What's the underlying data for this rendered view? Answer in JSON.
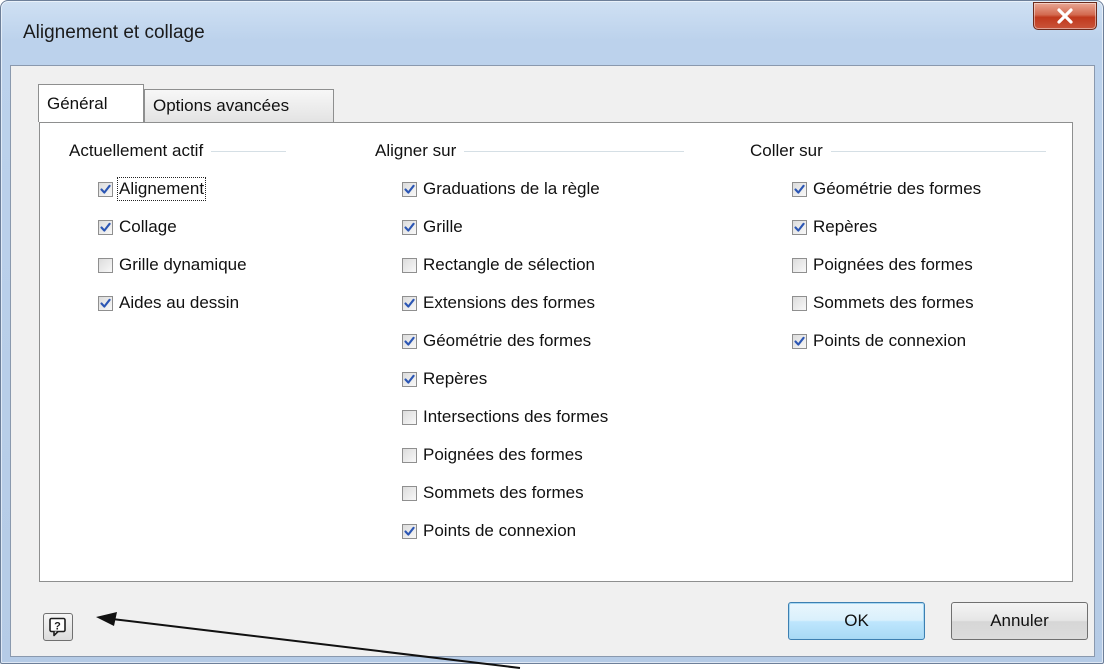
{
  "window": {
    "title": "Alignement et collage",
    "close_label": "X"
  },
  "tabs": [
    {
      "label": "Général",
      "active": true
    },
    {
      "label": "Options avancées",
      "active": false
    }
  ],
  "groups": {
    "actif": {
      "title": "Actuellement actif",
      "items": [
        {
          "label": "Alignement",
          "checked": true
        },
        {
          "label": "Collage",
          "checked": true
        },
        {
          "label": "Grille dynamique",
          "checked": false
        },
        {
          "label": "Aides au dessin",
          "checked": true
        }
      ]
    },
    "aligner": {
      "title": "Aligner sur",
      "items": [
        {
          "label": "Graduations de la règle",
          "checked": true
        },
        {
          "label": "Grille",
          "checked": true
        },
        {
          "label": "Rectangle de sélection",
          "checked": false
        },
        {
          "label": "Extensions des formes",
          "checked": true
        },
        {
          "label": "Géométrie des formes",
          "checked": true
        },
        {
          "label": "Repères",
          "checked": true
        },
        {
          "label": "Intersections des formes",
          "checked": false
        },
        {
          "label": "Poignées des formes",
          "checked": false
        },
        {
          "label": "Sommets des formes",
          "checked": false
        },
        {
          "label": "Points de connexion",
          "checked": true
        }
      ]
    },
    "coller": {
      "title": "Coller sur",
      "items": [
        {
          "label": "Géométrie des formes",
          "checked": true
        },
        {
          "label": "Repères",
          "checked": true
        },
        {
          "label": "Poignées des formes",
          "checked": false
        },
        {
          "label": "Sommets des formes",
          "checked": false
        },
        {
          "label": "Points de connexion",
          "checked": true
        }
      ]
    }
  },
  "buttons": {
    "help_icon": "help-icon",
    "ok": "OK",
    "cancel": "Annuler"
  },
  "colors": {
    "check": "#2b56b4",
    "default_button_border": "#3c7fb1",
    "close_button": "#c9543a"
  }
}
